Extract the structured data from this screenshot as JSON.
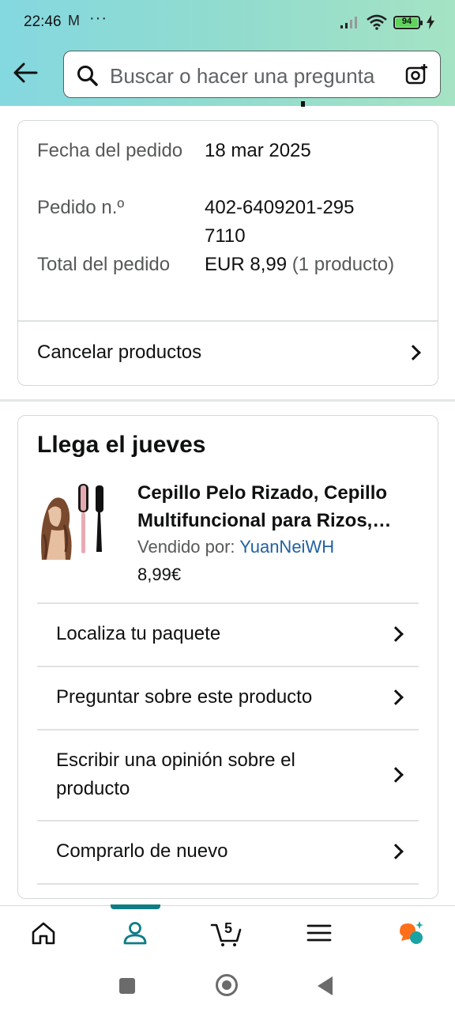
{
  "status_bar": {
    "time": "22:46",
    "notif_icon": "M",
    "more": "···",
    "battery_level": "94"
  },
  "search": {
    "placeholder": "Buscar o hacer una pregunta"
  },
  "order_summary": {
    "rows": [
      {
        "label": "Fecha del pedido",
        "value": "18 mar 2025"
      },
      {
        "label": "Pedido n.º",
        "value": "402-6409201-2957110"
      },
      {
        "label": "Total del pedido",
        "value": "EUR 8,99",
        "extra": "(1 producto)"
      }
    ],
    "cancel_label": "Cancelar productos"
  },
  "shipment": {
    "heading": "Llega el jueves",
    "product_title": "Cepillo Pelo Rizado, Cepillo Multifuncional para Rizos, Cepillo Desenredante",
    "seller_prefix": "Vendido por:",
    "seller_name": "YuanNeiWH",
    "price": "8,99€",
    "actions": [
      "Localiza tu paquete",
      "Preguntar sobre este producto",
      "Escribir una opinión sobre el producto",
      "Comprarlo de nuevo"
    ]
  },
  "bottom_nav": {
    "items": [
      "home-icon",
      "account-icon",
      "cart-icon",
      "menu-icon",
      "rufus-ai-icon"
    ],
    "active": "account-icon",
    "cart_count": "5",
    "accent": "#0e7c86"
  },
  "colors": {
    "header_gradient_start": "#84d8e0",
    "header_gradient_end": "#a5e3c4",
    "link": "#2162a1",
    "text": "#0f1111",
    "muted": "#565959"
  }
}
